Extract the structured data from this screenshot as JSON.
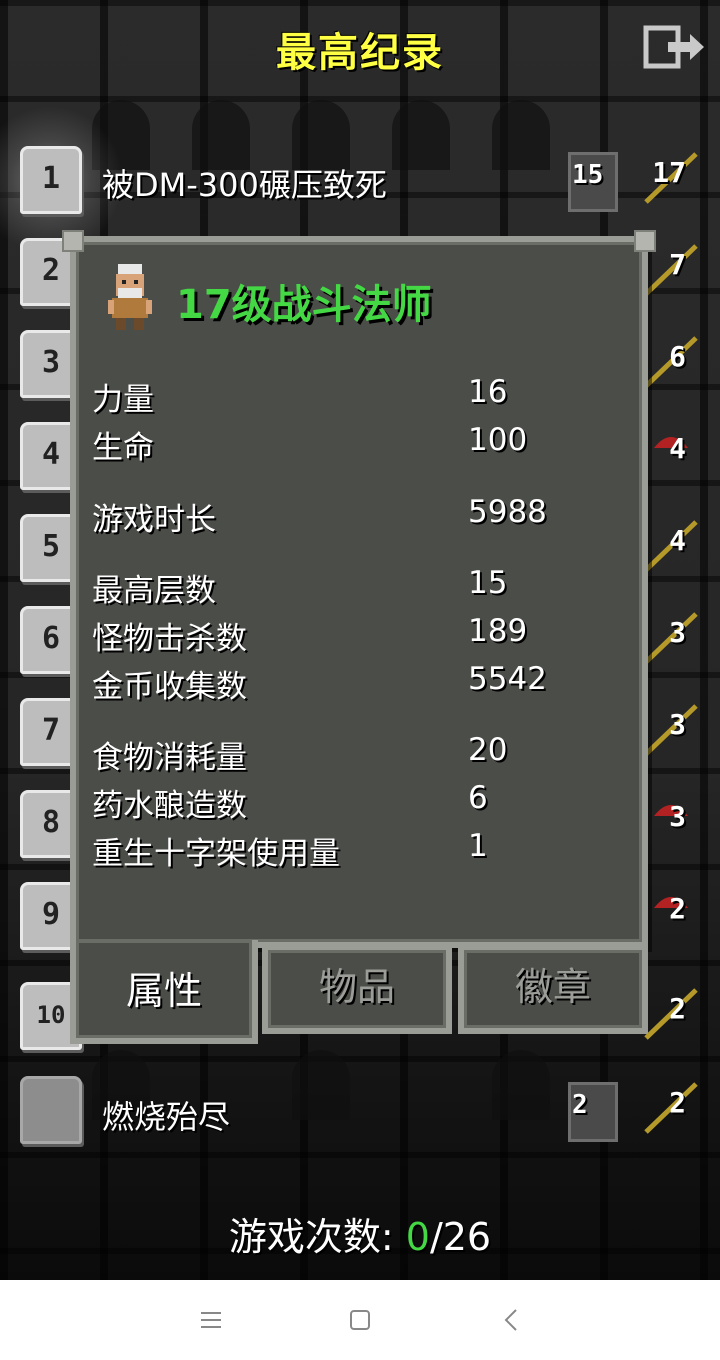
{
  "header": {
    "title": "最高纪录"
  },
  "rankings": [
    {
      "rank": "1",
      "text": "被DM-300碾压致死",
      "depth": "15",
      "level": "17"
    },
    {
      "rank": "2",
      "level": "7"
    },
    {
      "rank": "3",
      "level": "6"
    },
    {
      "rank": "4",
      "level": "4"
    },
    {
      "rank": "5",
      "level": "4"
    },
    {
      "rank": "6",
      "level": "3"
    },
    {
      "rank": "7",
      "level": "3"
    },
    {
      "rank": "8",
      "level": "3"
    },
    {
      "rank": "9",
      "level": "2"
    },
    {
      "rank": "10",
      "level": "2"
    },
    {
      "rank": "",
      "text": "燃烧殆尽",
      "depth": "2",
      "level": "2"
    }
  ],
  "dialog": {
    "hero_title": "17级战斗法师",
    "stats": [
      {
        "label": "力量",
        "value": "16"
      },
      {
        "label": "生命",
        "value": "100"
      },
      {
        "label": "游戏时长",
        "value": "5988"
      },
      {
        "label": "最高层数",
        "value": "15"
      },
      {
        "label": "怪物击杀数",
        "value": "189"
      },
      {
        "label": "金币收集数",
        "value": "5542"
      },
      {
        "label": "食物消耗量",
        "value": "20"
      },
      {
        "label": "药水酿造数",
        "value": "6"
      },
      {
        "label": "重生十字架使用量",
        "value": "1"
      }
    ],
    "tabs": [
      {
        "label": "属性",
        "active": true
      },
      {
        "label": "物品",
        "active": false
      },
      {
        "label": "徽章",
        "active": false
      }
    ]
  },
  "footer": {
    "prefix": "游戏次数: ",
    "current": "0",
    "total": "/26"
  },
  "colors": {
    "title": "#ffff44",
    "hero": "#44d944",
    "panel": "#4b4d49",
    "border": "#9a9c96"
  },
  "navbar": {
    "icons": [
      "menu-icon",
      "home-square-icon",
      "back-chevron-icon"
    ]
  }
}
